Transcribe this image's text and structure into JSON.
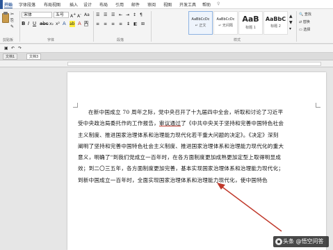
{
  "ribbon_tabs": [
    "开始",
    "字体段落",
    "布局视图",
    "插入",
    "设计",
    "布局",
    "引用",
    "邮件",
    "审阅",
    "视图",
    "开发工具",
    "帮助"
  ],
  "font": {
    "name": "宋体",
    "size": "五号"
  },
  "clipboard_label": "剪贴板",
  "font_group_label": "字体",
  "paragraph_group_label": "段落",
  "styles_group_label": "样式",
  "styles": [
    {
      "sample": "AaBbCcDc",
      "caption": "↵ 正文"
    },
    {
      "sample": "AaBbCcDc",
      "caption": "↵ 无间隔"
    },
    {
      "sample": "AaB",
      "caption": "标题 1"
    },
    {
      "sample": "AaBbC",
      "caption": "标题 2"
    }
  ],
  "editing": {
    "find": "查找",
    "replace": "替换",
    "select": "选择"
  },
  "doc_tabs": [
    "文档1",
    "文档3"
  ],
  "document": {
    "lines": [
      "在新中国成立 70 周年之际，党中央召开了十九届四中全会，听取和讨论了习近平",
      "受中央政治局委托作的工作报告，",
      "审议通过",
      "了《中共中央关于坚持和完善中国特色社会",
      "主义制度、推进国家治理体系和治理能力现代化若干重大问题的决定》。《决定》深刻",
      "阐明了坚持和完善中国特色社会主义制度、推进国家治理体系和治理能力现代化的重大",
      "意义，明确了\"到我们党成立一百年时，在各方面制度更加成熟更加定型上取得明显成",
      "效；到二〇三五年，各方面制度更加完善，基本实现国家治理体系和治理能力现代化；",
      "到新中国成立一百年时，全面实现国家治理体系和治理能力现代化，使中国特色"
    ]
  },
  "watermark_text": "头条 @悟空问答",
  "colors": {
    "accent": "#2b579a",
    "arrow": "#c0392b"
  }
}
